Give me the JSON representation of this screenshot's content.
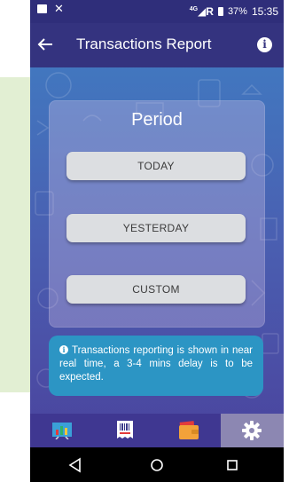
{
  "status_bar": {
    "network": "R",
    "network_sup": "4G",
    "battery": "37%",
    "time": "15:35"
  },
  "app_bar": {
    "title": "Transactions Report",
    "back_icon": "arrow-left-icon",
    "info_icon": "info-icon"
  },
  "period_card": {
    "title": "Period",
    "options": [
      "TODAY",
      "YESTERDAY",
      "CUSTOM"
    ]
  },
  "notice": {
    "icon": "info-icon",
    "text": "Transactions reporting is shown in near real time, a 3-4 mins delay is to be expected."
  },
  "bottom_nav": {
    "items": [
      {
        "icon": "chart-icon"
      },
      {
        "icon": "receipt-barcode-icon"
      },
      {
        "icon": "wallet-icon"
      },
      {
        "icon": "gear-icon"
      }
    ],
    "active_index": 3
  },
  "system_nav": {
    "items": [
      "back-triangle-icon",
      "home-circle-icon",
      "recents-square-icon"
    ]
  },
  "colors": {
    "status_bar": "#2f2e7a",
    "app_bar": "#34337f",
    "notice": "#2c95c4",
    "button": "#dcdee1",
    "side_panel": "#e2efd3"
  }
}
